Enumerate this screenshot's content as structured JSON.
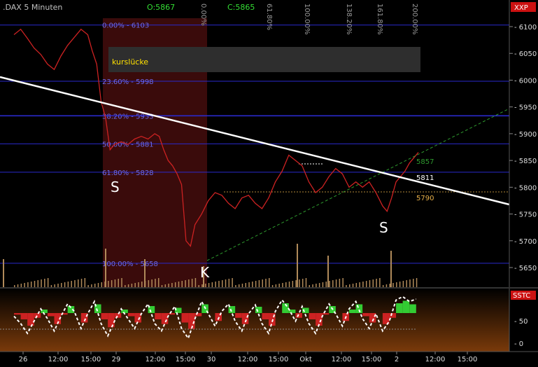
{
  "header": {
    "symbol": ".DAX 5 Minuten",
    "open": "O:5867",
    "close": "C:5865",
    "tag": "XXP"
  },
  "fib_top_labels": [
    "0.00%",
    "61.80%",
    "100.00%",
    "138.20%",
    "161.80%",
    "200.00%"
  ],
  "fib_levels": [
    {
      "label": "0.00% - 6103",
      "price": 6103
    },
    {
      "label": "23.60% - 5998",
      "price": 5998
    },
    {
      "label": "38.20% - 5933",
      "price": 5933
    },
    {
      "label": "50.00% - 5881",
      "price": 5881
    },
    {
      "label": "61.80% - 5828",
      "price": 5828
    },
    {
      "label": "100.00% - 5658",
      "price": 5658
    }
  ],
  "gap_label": "kurslücke",
  "markers": {
    "s_left": "S",
    "k": "K",
    "s_right": "S"
  },
  "price_tags": {
    "p5857": "5857",
    "p5811": "5811",
    "p5790": "5790"
  },
  "colors": {
    "up": "#cc2222",
    "fib": "#2a2acc",
    "trend": "#ffffff",
    "support": "#2e9a2e",
    "histo_pos": "#33cc33",
    "histo_neg": "#cc2222"
  },
  "chart_data": {
    "type": "line",
    "title": ".DAX 5 Minuten",
    "y_axis_ticks": [
      6100,
      6050,
      6000,
      5950,
      5900,
      5850,
      5800,
      5750,
      5700,
      5650
    ],
    "ylim": [
      5615,
      6125
    ],
    "x_axis_ticks": [
      "26",
      "12:00",
      "15:00",
      "29",
      "12:00",
      "15:00",
      "30",
      "12:00",
      "15:00",
      "Okt",
      "12:00",
      "15:00",
      "2",
      "12:00",
      "15:00"
    ],
    "price_series": [
      [
        0,
        6085
      ],
      [
        6,
        6095
      ],
      [
        12,
        6078
      ],
      [
        18,
        6060
      ],
      [
        24,
        6048
      ],
      [
        30,
        6030
      ],
      [
        36,
        6020
      ],
      [
        42,
        6045
      ],
      [
        48,
        6065
      ],
      [
        54,
        6080
      ],
      [
        60,
        6095
      ],
      [
        66,
        6085
      ],
      [
        70,
        6055
      ],
      [
        74,
        6030
      ],
      [
        78,
        5960
      ],
      [
        82,
        5930
      ],
      [
        86,
        5870
      ],
      [
        90,
        5880
      ],
      [
        96,
        5885
      ],
      [
        102,
        5880
      ],
      [
        108,
        5890
      ],
      [
        114,
        5895
      ],
      [
        120,
        5890
      ],
      [
        126,
        5900
      ],
      [
        130,
        5895
      ],
      [
        134,
        5870
      ],
      [
        138,
        5850
      ],
      [
        142,
        5840
      ],
      [
        146,
        5825
      ],
      [
        150,
        5805
      ],
      [
        154,
        5700
      ],
      [
        158,
        5690
      ],
      [
        162,
        5730
      ],
      [
        168,
        5750
      ],
      [
        174,
        5775
      ],
      [
        180,
        5790
      ],
      [
        186,
        5785
      ],
      [
        192,
        5770
      ],
      [
        198,
        5760
      ],
      [
        204,
        5780
      ],
      [
        210,
        5785
      ],
      [
        216,
        5770
      ],
      [
        222,
        5760
      ],
      [
        228,
        5780
      ],
      [
        234,
        5810
      ],
      [
        240,
        5830
      ],
      [
        246,
        5860
      ],
      [
        252,
        5850
      ],
      [
        258,
        5840
      ],
      [
        264,
        5810
      ],
      [
        270,
        5790
      ],
      [
        276,
        5800
      ],
      [
        282,
        5820
      ],
      [
        288,
        5835
      ],
      [
        294,
        5825
      ],
      [
        300,
        5800
      ],
      [
        306,
        5810
      ],
      [
        312,
        5800
      ],
      [
        318,
        5810
      ],
      [
        324,
        5790
      ],
      [
        330,
        5765
      ],
      [
        334,
        5755
      ],
      [
        338,
        5780
      ],
      [
        342,
        5810
      ],
      [
        346,
        5820
      ],
      [
        350,
        5830
      ],
      [
        354,
        5845
      ],
      [
        358,
        5855
      ],
      [
        362,
        5865
      ]
    ],
    "levels": {
      "kurslucke_top": 6060,
      "kurslucke_bottom": 6012
    },
    "oscillator": {
      "name": "SSTC",
      "y_axis_ticks": [
        50,
        0
      ],
      "ylim": [
        -5,
        100
      ],
      "k_line": [
        [
          0,
          55
        ],
        [
          6,
          40
        ],
        [
          12,
          20
        ],
        [
          18,
          45
        ],
        [
          24,
          70
        ],
        [
          30,
          50
        ],
        [
          36,
          25
        ],
        [
          42,
          55
        ],
        [
          48,
          80
        ],
        [
          54,
          65
        ],
        [
          60,
          30
        ],
        [
          66,
          60
        ],
        [
          72,
          85
        ],
        [
          78,
          40
        ],
        [
          84,
          15
        ],
        [
          90,
          45
        ],
        [
          96,
          70
        ],
        [
          102,
          50
        ],
        [
          108,
          30
        ],
        [
          114,
          60
        ],
        [
          120,
          80
        ],
        [
          126,
          40
        ],
        [
          132,
          25
        ],
        [
          138,
          55
        ],
        [
          144,
          75
        ],
        [
          150,
          30
        ],
        [
          156,
          10
        ],
        [
          162,
          50
        ],
        [
          168,
          85
        ],
        [
          174,
          60
        ],
        [
          180,
          35
        ],
        [
          186,
          65
        ],
        [
          192,
          80
        ],
        [
          198,
          45
        ],
        [
          204,
          25
        ],
        [
          210,
          60
        ],
        [
          216,
          78
        ],
        [
          222,
          40
        ],
        [
          228,
          20
        ],
        [
          234,
          65
        ],
        [
          240,
          88
        ],
        [
          246,
          70
        ],
        [
          252,
          45
        ],
        [
          258,
          75
        ],
        [
          264,
          40
        ],
        [
          270,
          20
        ],
        [
          276,
          55
        ],
        [
          282,
          80
        ],
        [
          288,
          60
        ],
        [
          294,
          35
        ],
        [
          300,
          70
        ],
        [
          306,
          85
        ],
        [
          312,
          50
        ],
        [
          318,
          30
        ],
        [
          324,
          60
        ],
        [
          330,
          25
        ],
        [
          336,
          45
        ],
        [
          342,
          88
        ],
        [
          348,
          95
        ],
        [
          354,
          85
        ],
        [
          360,
          90
        ]
      ]
    }
  }
}
